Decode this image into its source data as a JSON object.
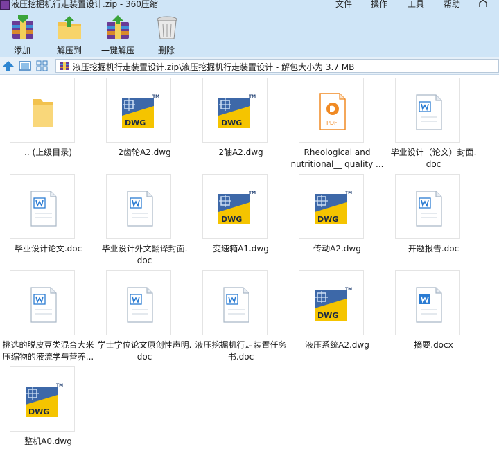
{
  "window": {
    "title": "液压挖掘机行走装置设计.zip - 360压缩",
    "menu": [
      "文件",
      "操作",
      "工具",
      "帮助"
    ]
  },
  "toolbar": {
    "add_label": "添加",
    "extract_label": "解压到",
    "one_click_label": "一键解压",
    "delete_label": "删除"
  },
  "address": {
    "path": "液压挖掘机行走装置设计.zip\\液压挖掘机行走装置设计 - 解包大小为 3.7 MB"
  },
  "icons": {
    "folder": "folder-icon",
    "dwg": "dwg-file-icon",
    "pdf": "pdf-file-icon",
    "doc": "word-doc-icon"
  },
  "files": [
    {
      "type": "folder",
      "line1": ".. (上级目录)",
      "line2": ""
    },
    {
      "type": "dwg",
      "line1": "2齿轮A2.dwg",
      "line2": ""
    },
    {
      "type": "dwg",
      "line1": "2轴A2.dwg",
      "line2": ""
    },
    {
      "type": "pdf",
      "line1": "Rheological and",
      "line2": "nutritional__ quality ..."
    },
    {
      "type": "doc",
      "line1": "毕业设计（论文）封面.",
      "line2": "doc"
    },
    {
      "type": "doc",
      "line1": "毕业设计论文.doc",
      "line2": ""
    },
    {
      "type": "doc",
      "line1": "毕业设计外文翻译封面.",
      "line2": "doc"
    },
    {
      "type": "dwg",
      "line1": "变速箱A1.dwg",
      "line2": ""
    },
    {
      "type": "dwg",
      "line1": "传动A2.dwg",
      "line2": ""
    },
    {
      "type": "doc",
      "line1": "开题报告.doc",
      "line2": ""
    },
    {
      "type": "doc",
      "line1": "挑选的脱皮豆类混合大米",
      "line2": "压缩物的液流学与营养..."
    },
    {
      "type": "doc",
      "line1": "学士学位论文原创性声明.",
      "line2": "doc"
    },
    {
      "type": "doc",
      "line1": "液压挖掘机行走装置任务",
      "line2": "书.doc"
    },
    {
      "type": "dwg",
      "line1": "液压系统A2.dwg",
      "line2": ""
    },
    {
      "type": "docx",
      "line1": "摘要.docx",
      "line2": ""
    },
    {
      "type": "dwg",
      "line1": "整机A0.dwg",
      "line2": ""
    }
  ],
  "colors": {
    "chrome": "#cfe5f7",
    "dwg_yellow": "#f5c400",
    "dwg_navy": "#2d4a7a",
    "pdf_orange": "#f08a24",
    "word_blue": "#2b7cd3"
  }
}
